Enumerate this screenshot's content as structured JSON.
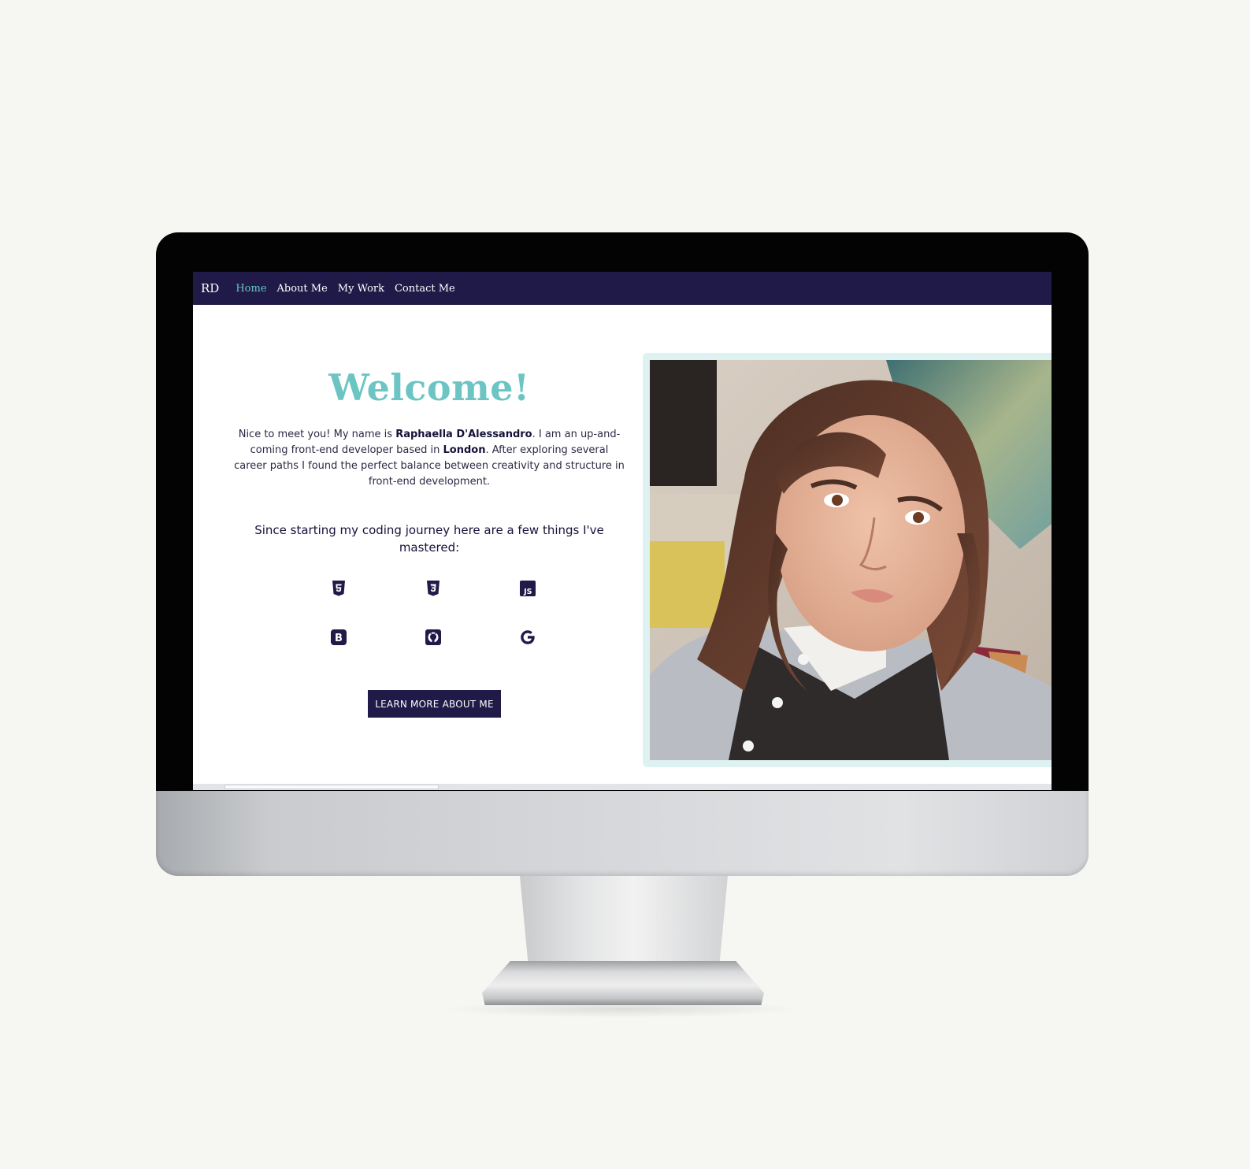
{
  "nav": {
    "brand": "RD",
    "links": [
      "Home",
      "About Me",
      "My Work",
      "Contact Me"
    ],
    "active": "Home"
  },
  "hero": {
    "title": "Welcome!",
    "intro": {
      "p1": "Nice to meet you! My name is ",
      "name": "Raphaella D'Alessandro",
      "p2": ". I am an up-and-coming front-end developer based in ",
      "city": "London",
      "p3": ". After exploring several career paths I found the perfect balance between creativity and structure in front-end development."
    },
    "skills_heading": "Since starting my coding journey here are a few things I've mastered:",
    "skills": [
      {
        "icon": "html5-icon"
      },
      {
        "icon": "css3-icon"
      },
      {
        "icon": "javascript-icon",
        "text": "JS"
      },
      {
        "icon": "bootstrap-icon",
        "text": "B"
      },
      {
        "icon": "github-icon"
      },
      {
        "icon": "google-icon"
      }
    ],
    "cta_label": "LEARN MORE ABOUT ME"
  },
  "colors": {
    "navy": "#1f1a47",
    "teal": "#6cc5c3",
    "photo_frame": "#def2f1"
  }
}
